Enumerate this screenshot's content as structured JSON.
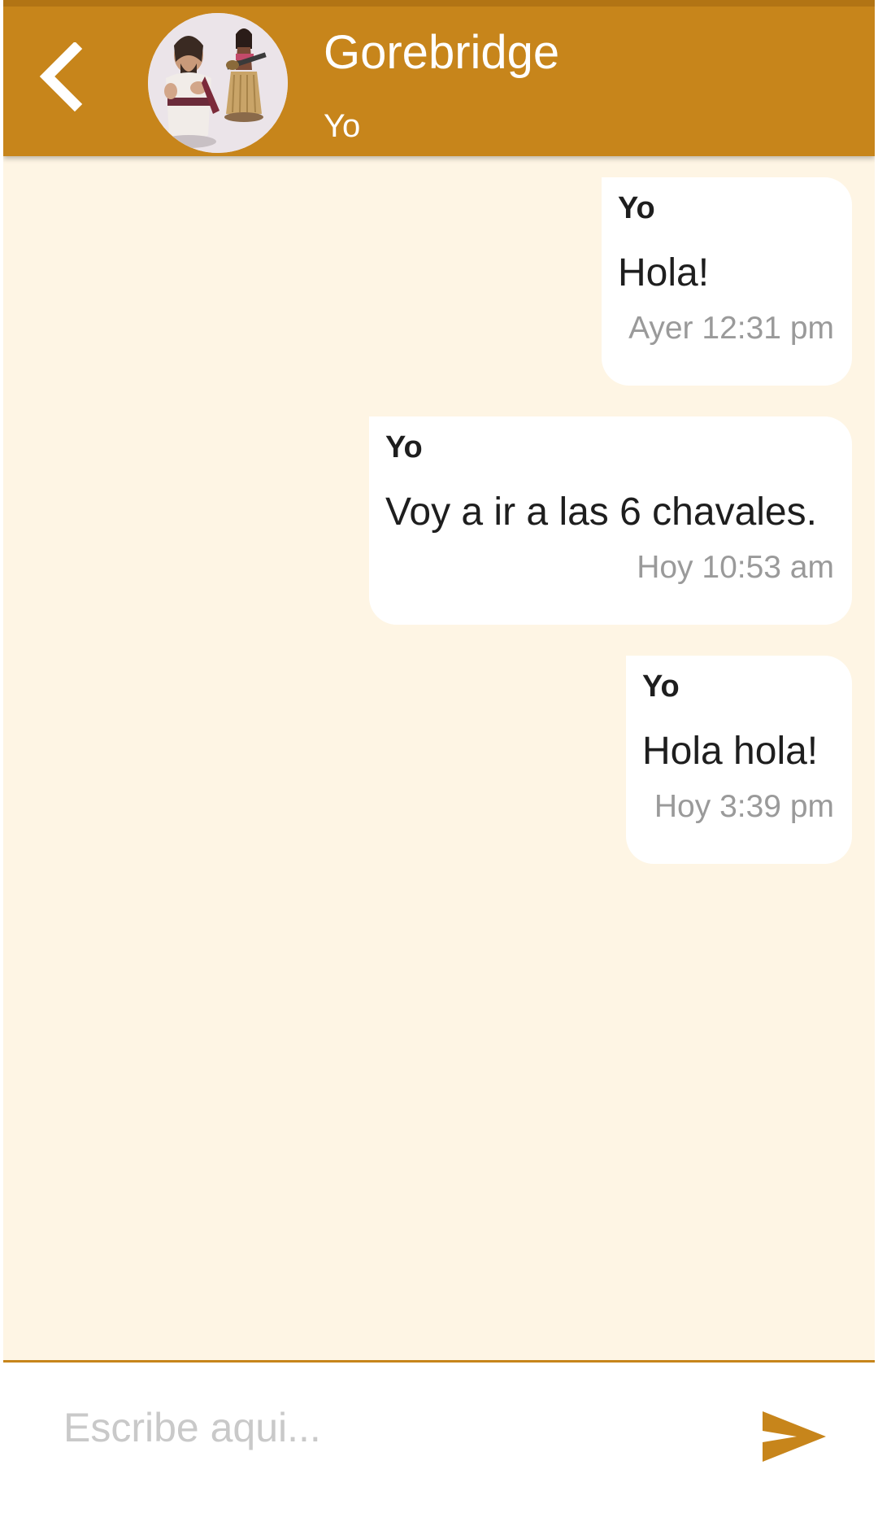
{
  "header": {
    "title": "Gorebridge",
    "subtitle": "Yo",
    "accent_color": "#c7851b",
    "back_icon": "chevron-left-icon",
    "avatar": "group-avatar"
  },
  "messages": [
    {
      "sender": "Yo",
      "text": "Hola!",
      "time": "Ayer 12:31 pm"
    },
    {
      "sender": "Yo",
      "text": "Voy a ir a las 6 chavales.",
      "time": "Hoy 10:53 am"
    },
    {
      "sender": "Yo",
      "text": "Hola hola!",
      "time": "Hoy 3:39 pm"
    }
  ],
  "composer": {
    "placeholder": "Escribe aqui...",
    "value": "",
    "send_icon": "send-icon"
  },
  "colors": {
    "background": "#fef5e4",
    "bubble": "#ffffff",
    "time_text": "#9a9a9a"
  }
}
